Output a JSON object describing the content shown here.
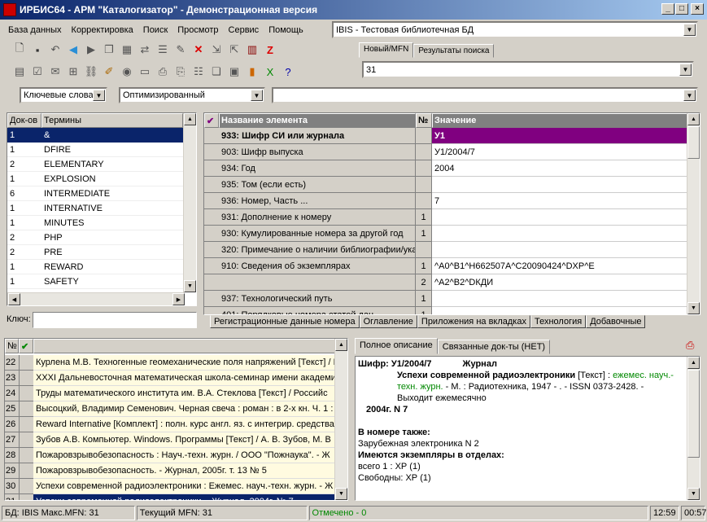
{
  "window": {
    "title": "ИРБИС64 - АРМ \"Каталогизатор\" - Демонстрационная версия"
  },
  "menu": [
    "База данных",
    "Корректировка",
    "Поиск",
    "Просмотр",
    "Сервис",
    "Помощь"
  ],
  "db_select": "IBIS - Тестовая библиотечная БД",
  "mfn_tabs": [
    "Новый/MFN",
    "Результаты поиска"
  ],
  "mfn_value": "31",
  "search": {
    "mode": "Ключевые слова",
    "optimize": "Оптимизированный",
    "query": ""
  },
  "terms": {
    "headers": [
      "Док-ов",
      "Термины"
    ],
    "rows": [
      [
        "1",
        "&"
      ],
      [
        "1",
        "DFIRE"
      ],
      [
        "2",
        "ELEMENTARY"
      ],
      [
        "1",
        "EXPLOSION"
      ],
      [
        "6",
        "INTERMEDIATE"
      ],
      [
        "1",
        "INTERNATIVE"
      ],
      [
        "1",
        "MINUTES"
      ],
      [
        "2",
        "PHP"
      ],
      [
        "2",
        "PRE"
      ],
      [
        "1",
        "REWARD"
      ],
      [
        "1",
        "SAFETY"
      ]
    ],
    "key_label": "Ключ:"
  },
  "fields": {
    "headers": [
      "Название элемента",
      "№",
      "Значение"
    ],
    "rows": [
      {
        "name": "933: Шифр СИ или журнала",
        "num": "",
        "value": "У1"
      },
      {
        "name": "903: Шифр выпуска",
        "num": "",
        "value": "У1/2004/7"
      },
      {
        "name": "934: Год",
        "num": "",
        "value": "2004"
      },
      {
        "name": "935: Том (если есть)",
        "num": "",
        "value": ""
      },
      {
        "name": "936: Номер, Часть ...",
        "num": "",
        "value": "7"
      },
      {
        "name": "931: Дополнение к номеру",
        "num": "1",
        "value": ""
      },
      {
        "name": "930: Кумулированные номера за другой год",
        "num": "1",
        "value": ""
      },
      {
        "name": "320: Примечание о наличии библиографии/указ",
        "num": "",
        "value": ""
      },
      {
        "name": "910: Сведения об экземплярах",
        "num": "1",
        "value": "^A0^B1^H662507A^C20090424^DXP^E"
      },
      {
        "name": "",
        "num": "2",
        "value": "^A2^B2^DКДИ"
      },
      {
        "name": "937: Технологический путь",
        "num": "1",
        "value": ""
      },
      {
        "name": "401: Порядковые номера статей дан",
        "num": "1",
        "value": ""
      }
    ],
    "tabs": [
      "Регистрационные данные номера",
      "Оглавление",
      "Приложения на вкладках",
      "Технология",
      "Добавочные"
    ]
  },
  "records": {
    "headers": [
      "№",
      "✔"
    ],
    "rows": [
      {
        "n": "22",
        "text": "Курлена М.В. Техногенные геомеханические поля напряжений [Текст] / Н"
      },
      {
        "n": "23",
        "text": "XXXI Дальневосточная математическая школа-семинар имени академи"
      },
      {
        "n": "24",
        "text": "Труды математического института им. В.А. Стеклова [Текст] / Российс"
      },
      {
        "n": "25",
        "text": "Высоцкий, Владимир Семенович. Черная свеча : роман : в 2-х кн. Ч. 1 : Р"
      },
      {
        "n": "26",
        "text": "Reward Internative [Комплект] : полн. курс англ. яз. с интегрир. средства"
      },
      {
        "n": "27",
        "text": "Зубов А.В. Компьютер. Windows. Программы [Текст] / А. В. Зубов, М. В"
      },
      {
        "n": "28",
        "text": "Пожаровзрывобезопасность : Науч.-техн. журн. / ООО \"Пожнаука\". - Ж"
      },
      {
        "n": "29",
        "text": "Пожаровзрывобезопасность. - Журнал, 2005г. т. 13 № 5"
      },
      {
        "n": "30",
        "text": "Успехи современной радиоэлектроники : Ежемес. науч.-техн. журн. - Ж"
      },
      {
        "n": "31",
        "text": "Успехи современной радиоэлектроники. - Журнал, 2004г. № 7"
      }
    ]
  },
  "desc": {
    "tabs": [
      "Полное описание",
      "Связанные док-ты (НЕТ)"
    ],
    "shifr": "Шифр: У1/2004/7",
    "journal": "Журнал",
    "title": "Успехи современной радиоэлектроники",
    "kind": "[Текст] :",
    "green1": "ежемес. науч.-техн. журн.",
    "pub": "- М. : Радиотехника, 1947 - . - ISSN 0373-2428. - Выходит ежемесячно",
    "year": "2004г. N 7",
    "also_h": "В номере также:",
    "also": "Зарубежная электроника N 2",
    "copies_h": "Имеются экземпляры в отделах:",
    "copies1": "всего 1 : ХР (1)",
    "copies2": "Свободны: ХР (1)"
  },
  "status": {
    "db": "БД: IBIS Макс.MFN: 31",
    "current": "Текущий MFN: 31",
    "marked": "Отмечено - 0",
    "time1": "12:59",
    "time2": "00:57"
  }
}
